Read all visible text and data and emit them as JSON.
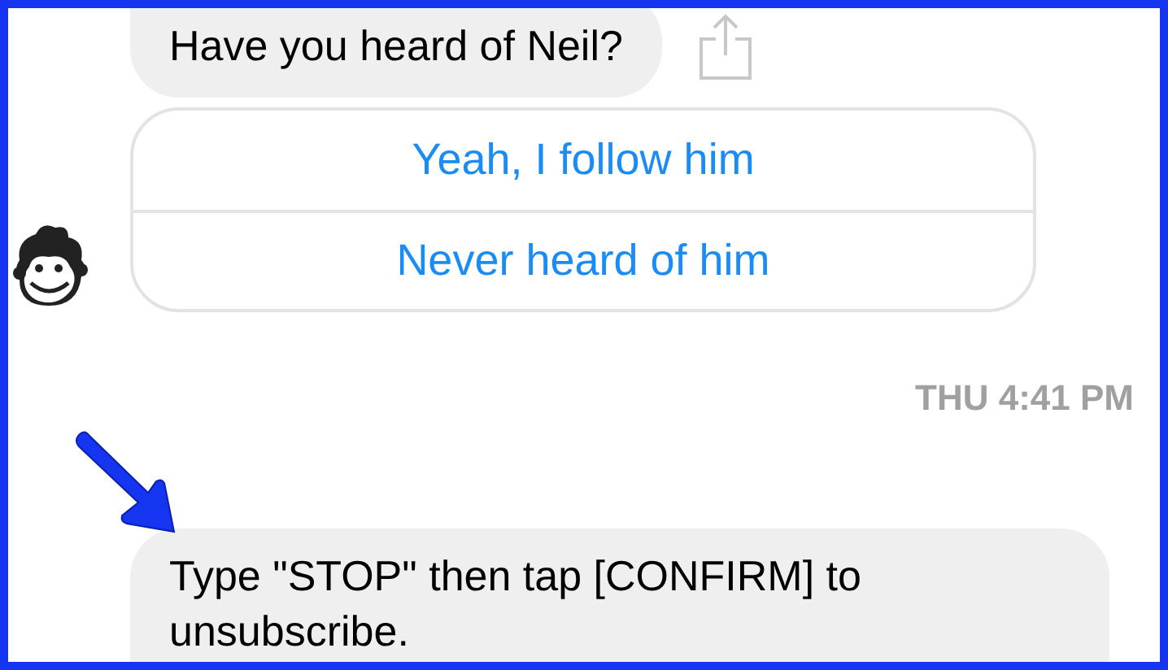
{
  "conversation": [
    {
      "kind": "bubble",
      "text": "Have you heard of Neil?",
      "share": true
    },
    {
      "kind": "quick_replies",
      "options": [
        "Yeah, I follow him",
        "Never heard of him"
      ],
      "avatar": true
    },
    {
      "kind": "timestamp",
      "text": "THU 4:41 PM"
    },
    {
      "kind": "bubble",
      "text": "Type \"STOP\" then tap [CONFIRM] to unsubscribe.",
      "share": false,
      "annotated": true
    }
  ]
}
